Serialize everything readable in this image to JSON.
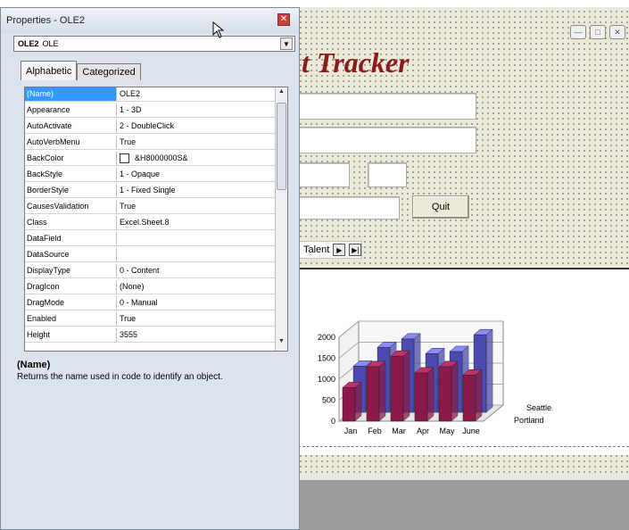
{
  "designer": {
    "form_title": "t Tracker",
    "quit_label": "Quit",
    "nav_label": "Talent"
  },
  "properties": {
    "title": "Properties - OLE2",
    "object_name": "OLE2",
    "object_type": "OLE",
    "tabs": [
      "Alphabetic",
      "Categorized"
    ],
    "rows": [
      {
        "name": "(Name)",
        "value": "OLE2",
        "selected": true
      },
      {
        "name": "Appearance",
        "value": "1 - 3D"
      },
      {
        "name": "AutoActivate",
        "value": "2 - DoubleClick"
      },
      {
        "name": "AutoVerbMenu",
        "value": "True"
      },
      {
        "name": "BackColor",
        "value": "&H8000000S&",
        "swatch": true
      },
      {
        "name": "BackStyle",
        "value": "1 - Opaque"
      },
      {
        "name": "BorderStyle",
        "value": "1 - Fixed Single"
      },
      {
        "name": "CausesValidation",
        "value": "True"
      },
      {
        "name": "Class",
        "value": "Excel.Sheet.8"
      },
      {
        "name": "DataField",
        "value": ""
      },
      {
        "name": "DataSource",
        "value": ""
      },
      {
        "name": "DisplayType",
        "value": "0 - Content"
      },
      {
        "name": "DragIcon",
        "value": "(None)"
      },
      {
        "name": "DragMode",
        "value": "0 - Manual"
      },
      {
        "name": "Enabled",
        "value": "True"
      },
      {
        "name": "Height",
        "value": "3555"
      }
    ],
    "description_title": "(Name)",
    "description_text": "Returns the name used in code to identify an object."
  },
  "chart_data": {
    "type": "bar",
    "categories": [
      "Jan",
      "Feb",
      "Mar",
      "Apr",
      "May",
      "June"
    ],
    "series": [
      {
        "name": "Portland",
        "values": [
          800,
          1300,
          1550,
          1150,
          1300,
          1100
        ],
        "color": "#8b1a4a"
      },
      {
        "name": "Seattle",
        "values": [
          1100,
          1550,
          1750,
          1400,
          1450,
          1850
        ],
        "color": "#4a4ab0"
      }
    ],
    "yticks": [
      "0",
      "500",
      "1000",
      "1500",
      "2000"
    ],
    "ylim": [
      0,
      2000
    ]
  }
}
